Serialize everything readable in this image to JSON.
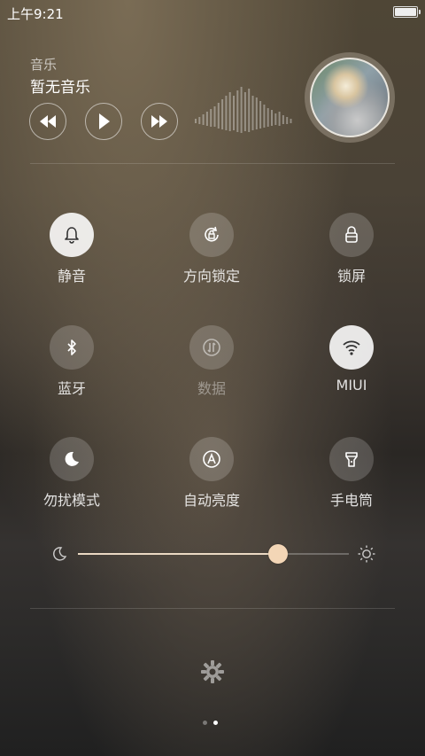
{
  "status_bar": {
    "time": "上午9:21",
    "battery_level": 1.0
  },
  "music": {
    "label": "音乐",
    "title": "暂无音乐",
    "controls": [
      "rewind-icon",
      "play-icon",
      "fast-forward-icon"
    ]
  },
  "toggles": [
    {
      "label": "静音",
      "icon": "bell-icon",
      "active": true
    },
    {
      "label": "方向锁定",
      "icon": "rotation-lock-icon",
      "active": false
    },
    {
      "label": "锁屏",
      "icon": "lock-icon",
      "active": false
    },
    {
      "label": "蓝牙",
      "icon": "bluetooth-icon",
      "active": false
    },
    {
      "label": "数据",
      "icon": "data-icon",
      "active": false,
      "disabled": true
    },
    {
      "label": "MIUI",
      "icon": "wifi-icon",
      "active": true
    },
    {
      "label": "勿扰模式",
      "icon": "moon-icon",
      "active": false
    },
    {
      "label": "自动亮度",
      "icon": "auto-brightness-icon",
      "active": false
    },
    {
      "label": "手电筒",
      "icon": "flashlight-icon",
      "active": false
    }
  ],
  "brightness": {
    "value": 0.74,
    "low_icon": "moon-icon",
    "high_icon": "sun-icon"
  },
  "pager": {
    "pages": 2,
    "current": 2
  },
  "colors": {
    "thumb": "#f3d6b6",
    "active_tile": "#ebebeb"
  }
}
